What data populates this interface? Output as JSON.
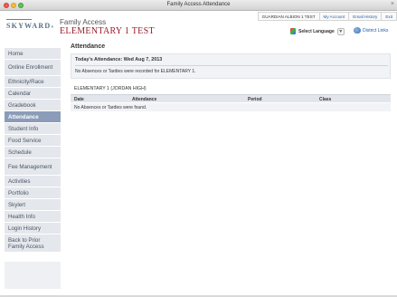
{
  "window": {
    "title": "Family Access Attendance",
    "close_glyph": "×"
  },
  "header": {
    "logo_text": "SKYWARD",
    "logo_mark": "®",
    "app_label": "Family Access",
    "school": "ELEMENTARY 1 TEST"
  },
  "toplinks": {
    "guardian": "GUARDIAN ALBION 1 TEST",
    "my_account": "My Account",
    "email_history": "Email History",
    "exit": "Exit"
  },
  "language": {
    "label": "Select Language",
    "caret": "▼"
  },
  "district_links": "District Links",
  "sidebar": {
    "items": [
      {
        "label": "Home",
        "active": false
      },
      {
        "label": "Online Enrollment",
        "active": false
      },
      {
        "label": "Ethnicity/Race",
        "active": false
      },
      {
        "label": "Calendar",
        "active": false
      },
      {
        "label": "Gradebook",
        "active": false
      },
      {
        "label": "Attendance",
        "active": true
      },
      {
        "label": "Student Info",
        "active": false
      },
      {
        "label": "Food Service",
        "active": false
      },
      {
        "label": "Schedule",
        "active": false
      },
      {
        "label": "Fee Management",
        "active": false
      },
      {
        "label": "Activities",
        "active": false
      },
      {
        "label": "Portfolio",
        "active": false
      },
      {
        "label": "Skylert",
        "active": false
      },
      {
        "label": "Health Info",
        "active": false
      },
      {
        "label": "Login History",
        "active": false
      },
      {
        "label": "Back to Prior Family Access",
        "active": false
      }
    ]
  },
  "main": {
    "title": "Attendance",
    "today_title": "Today's Attendance: Wed Aug 7, 2013",
    "today_message": "No Absences or Tardies were recorded for ELEMENTARY 1.",
    "school_header": "ELEMENTARY 1 (JORDAN HIGH)",
    "columns": {
      "date": "Date",
      "attendance": "Attendance",
      "period": "Period",
      "class": "Class"
    },
    "empty_message": "No Absences or Tardies were found."
  }
}
